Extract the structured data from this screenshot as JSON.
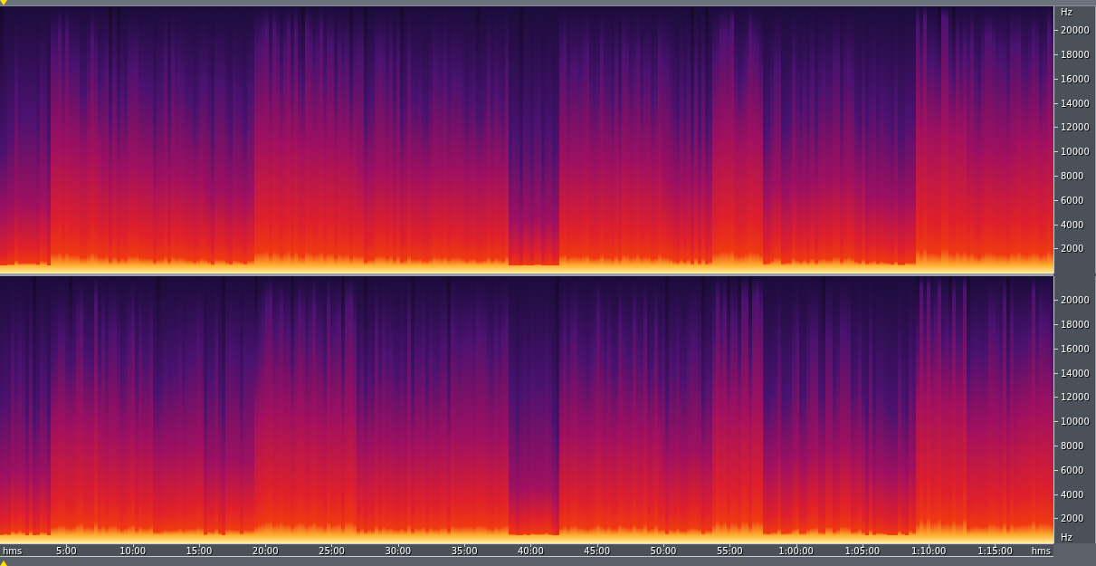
{
  "channels": [
    {
      "unit_label_top": "Hz",
      "freq_ticks": [
        "20000",
        "18000",
        "16000",
        "14000",
        "12000",
        "10000",
        "8000",
        "6000",
        "4000",
        "2000"
      ]
    },
    {
      "unit_label_bottom": "Hz",
      "freq_ticks": [
        "20000",
        "18000",
        "16000",
        "14000",
        "12000",
        "10000",
        "8000",
        "6000",
        "4000",
        "2000"
      ]
    }
  ],
  "time_ruler": {
    "start_label": "hms",
    "end_label": "hms",
    "ticks": [
      "5:00",
      "10:00",
      "15:00",
      "20:00",
      "25:00",
      "30:00",
      "35:00",
      "40:00",
      "45:00",
      "50:00",
      "55:00",
      "1:00:00",
      "1:05:00",
      "1:10:00",
      "1:15:00"
    ]
  }
}
